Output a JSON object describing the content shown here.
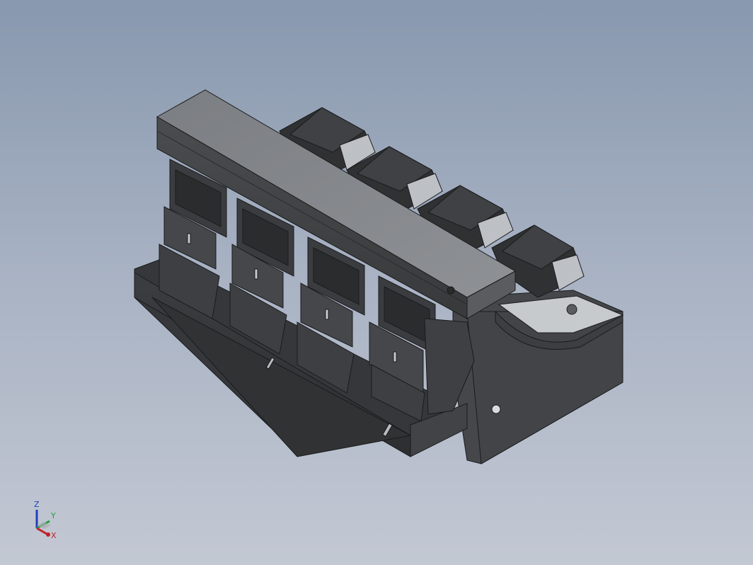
{
  "viewport": {
    "background_top": "#8898ae",
    "background_bottom": "#c3c8d3"
  },
  "model": {
    "icon": "multihead-weigher-assembly",
    "body_color": "#3f4144",
    "top_color": "#85888c",
    "edge_color": "#1a1b1c"
  },
  "triad": {
    "x_label": "X",
    "y_label": "Y",
    "z_label": "Z",
    "x_color": "#c0202a",
    "y_color": "#20a040",
    "z_color": "#2040c0"
  }
}
